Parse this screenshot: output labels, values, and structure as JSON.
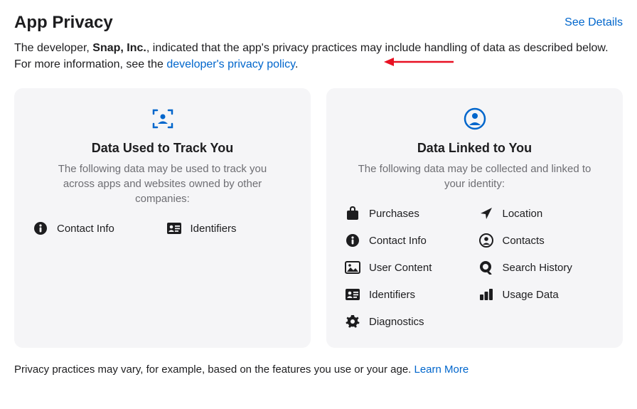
{
  "header": {
    "title": "App Privacy",
    "see_details": "See Details"
  },
  "intro": {
    "prefix": "The developer, ",
    "developer": "Snap, Inc.",
    "middle": ", indicated that the app's privacy practices may include handling of data as described below. For more information, see the ",
    "link": "developer's privacy policy",
    "suffix": "."
  },
  "cards": {
    "track": {
      "title": "Data Used to Track You",
      "subtitle": "The following data may be used to track you across apps and websites owned by other companies:",
      "items": [
        {
          "icon": "info",
          "label": "Contact Info"
        },
        {
          "icon": "id-card",
          "label": "Identifiers"
        }
      ]
    },
    "linked": {
      "title": "Data Linked to You",
      "subtitle": "The following data may be collected and linked to your identity:",
      "items": [
        {
          "icon": "bag",
          "label": "Purchases"
        },
        {
          "icon": "location",
          "label": "Location"
        },
        {
          "icon": "info",
          "label": "Contact Info"
        },
        {
          "icon": "contacts",
          "label": "Contacts"
        },
        {
          "icon": "photo",
          "label": "User Content"
        },
        {
          "icon": "search",
          "label": "Search History"
        },
        {
          "icon": "id-card",
          "label": "Identifiers"
        },
        {
          "icon": "chart",
          "label": "Usage Data"
        },
        {
          "icon": "gear",
          "label": "Diagnostics"
        }
      ]
    }
  },
  "footer": {
    "text": "Privacy practices may vary, for example, based on the features you use or your age. ",
    "link": "Learn More"
  }
}
